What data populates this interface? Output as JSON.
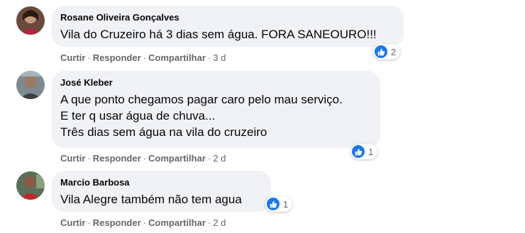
{
  "comments": [
    {
      "author": "Rosane Oliveira Gonçalves",
      "text": "Vila do Cruzeiro há 3 dias sem água. FORA SANEOURO!!!",
      "actions": {
        "like": "Curtir",
        "reply": "Responder",
        "share": "Compartilhar",
        "time": "3 d"
      },
      "reactions": {
        "count": "2",
        "icon": "like-icon"
      }
    },
    {
      "author": "José Kleber",
      "text": "A que ponto chegamos pagar caro pelo mau serviço.\nE ter q usar água de chuva...\nTrês dias sem água na vila do cruzeiro",
      "actions": {
        "like": "Curtir",
        "reply": "Responder",
        "share": "Compartilhar",
        "time": "2 d"
      },
      "reactions": {
        "count": "1",
        "icon": "like-icon"
      }
    },
    {
      "author": "Marcio Barbosa",
      "text": "Vila Alegre também não tem agua",
      "actions": {
        "like": "Curtir",
        "reply": "Responder",
        "share": "Compartilhar",
        "time": "2 d"
      },
      "reactions": {
        "count": "1",
        "icon": "like-icon"
      }
    }
  ],
  "separator": "·",
  "colors": {
    "bubble": "#f0f2f5",
    "like_blue": "#1877f2",
    "meta_text": "#65676b",
    "text": "#050505"
  }
}
